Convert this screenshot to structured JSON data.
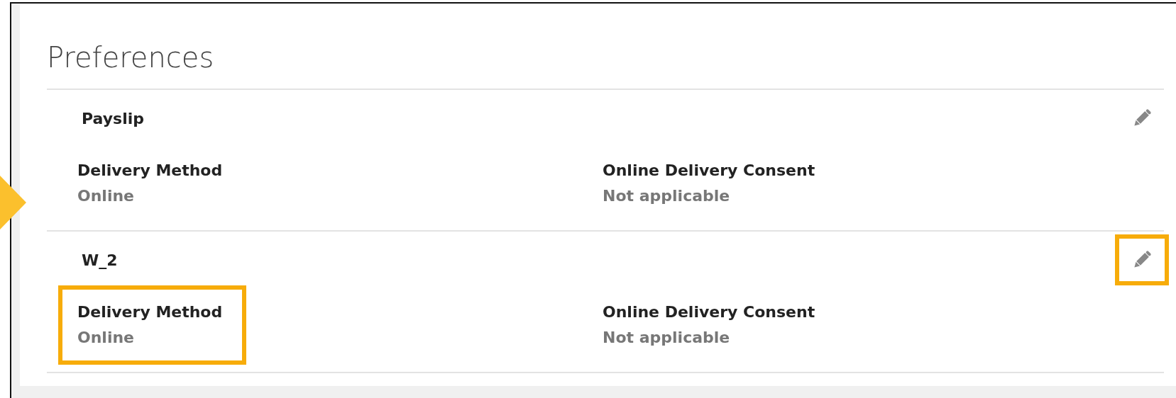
{
  "title": "Preferences",
  "sections": [
    {
      "heading": "Payslip",
      "edit_highlighted": false,
      "fields": [
        {
          "label": "Delivery Method",
          "value": "Online",
          "highlighted": false
        },
        {
          "label": "Online Delivery Consent",
          "value": "Not applicable",
          "highlighted": false
        }
      ]
    },
    {
      "heading": "W_2",
      "edit_highlighted": true,
      "fields": [
        {
          "label": "Delivery Method",
          "value": "Online",
          "highlighted": true
        },
        {
          "label": "Online Delivery Consent",
          "value": "Not applicable",
          "highlighted": false
        }
      ]
    }
  ]
}
